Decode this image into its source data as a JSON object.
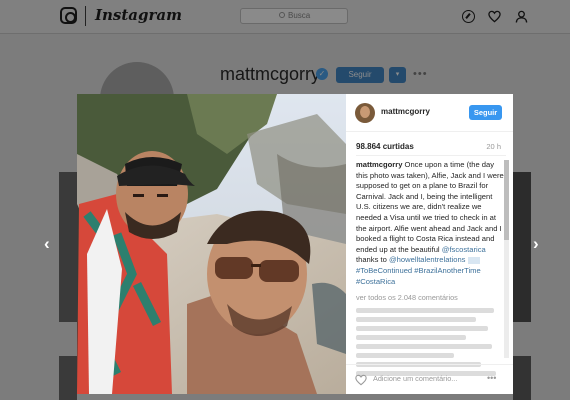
{
  "topbar": {
    "logo_text": "Instagram",
    "search_placeholder": "Busca",
    "icons": [
      "instagram-logo-icon",
      "compass-icon",
      "heart-icon",
      "person-icon"
    ]
  },
  "profile": {
    "username": "mattmcgorry",
    "verified_mark": "✓",
    "follow_label": "Seguir",
    "dropdown_label": "▾",
    "more_label": "•••"
  },
  "nav": {
    "prev_label": "‹",
    "next_label": "›"
  },
  "post": {
    "username": "mattmcgorry",
    "follow_label": "Seguir",
    "likes": "98.864 curtidas",
    "time": "20 h",
    "caption_user": "mattmcgorry",
    "caption_text": "Once upon a time (the day this photo was taken), Alfie, Jack and I were supposed to get on a plane to Brazil for Carnival. Jack and I, being the intelligent U.S. citizens we are, didn't realize we needed a Visa until we tried to check in at the airport. Alfie went ahead and Jack and I booked a flight to Costa Rica instead and ended up at the beautiful",
    "mention_1": "@fscostarica",
    "thanks_text": "thanks to",
    "mention_2": "@howelltalentrelations",
    "hashtag_1": "#ToBeContinued",
    "hashtag_2": "#BrazilAnotherTime",
    "hashtag_3": "#CostaRica",
    "view_all": "ver todos os 2.048 comentários",
    "comment_placeholder": "Adicione um comentário...",
    "more_label": "•••"
  },
  "colors": {
    "accent": "#3897f0",
    "link": "#3f729b",
    "overlay": "#7c7c7c"
  }
}
